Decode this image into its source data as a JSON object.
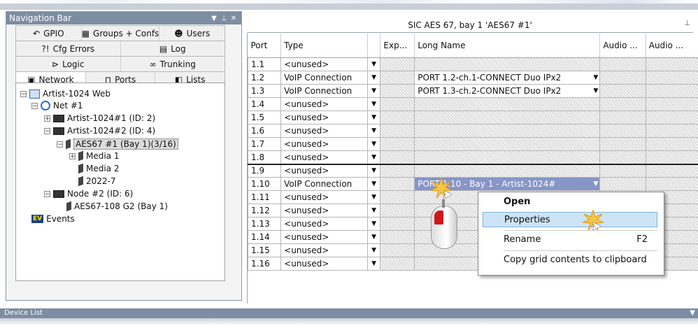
{
  "nav": {
    "title": "Navigation Bar",
    "tabs_row1": [
      {
        "icon": "gpio-icon",
        "glyph": "↶",
        "label": "GPIO"
      },
      {
        "icon": "groups-icon",
        "glyph": "▦",
        "label": "Groups + Confs"
      },
      {
        "icon": "users-icon",
        "glyph": "☻",
        "label": "Users"
      }
    ],
    "tabs_row2": [
      {
        "icon": "cfg-errors-icon",
        "glyph": "?!",
        "label": "Cfg Errors"
      },
      {
        "icon": "log-icon",
        "glyph": "▤",
        "label": "Log"
      }
    ],
    "tabs_row3": [
      {
        "icon": "logic-icon",
        "glyph": "⊳",
        "label": "Logic"
      },
      {
        "icon": "trunking-icon",
        "glyph": "∞",
        "label": "Trunking"
      }
    ],
    "tabs_row4": [
      {
        "icon": "network-icon",
        "glyph": "▣",
        "label": "Network"
      },
      {
        "icon": "ports-icon",
        "glyph": "⊓",
        "label": "Ports"
      },
      {
        "icon": "lists-icon",
        "glyph": "◧",
        "label": "Lists"
      }
    ],
    "tree": {
      "root": "Artist-1024 Web",
      "net": "Net #1",
      "dev1": "Artist-1024#1 (ID: 2)",
      "dev2": "Artist-1024#2 (ID: 4)",
      "aes": "AES67 #1 (Bay  1)(3/16)",
      "media1": "Media 1",
      "media2": "Media 2",
      "y2022": "2022-7",
      "node2": "Node #2 (ID: 6)",
      "aes108": "AES67-108 G2 (Bay  1)",
      "events_badge": "EV",
      "events": "Events"
    }
  },
  "grid": {
    "title": "SIC AES 67, bay 1 'AES67 #1'",
    "headers": {
      "port": "Port",
      "type": "Type",
      "exp": "Exp...",
      "longname": "Long Name",
      "audio1": "Audio ...",
      "audio2": "Audio ..."
    },
    "rows": [
      {
        "port": "1.1",
        "type": "<unused>",
        "long": ""
      },
      {
        "port": "1.2",
        "type": "VoIP Connection",
        "long": "PORT 1.2-ch.1-CONNECT Duo IPx2"
      },
      {
        "port": "1.3",
        "type": "VoIP Connection",
        "long": "PORT 1.3-ch.2-CONNECT Duo IPx2"
      },
      {
        "port": "1.4",
        "type": "<unused>",
        "long": ""
      },
      {
        "port": "1.5",
        "type": "<unused>",
        "long": ""
      },
      {
        "port": "1.6",
        "type": "<unused>",
        "long": ""
      },
      {
        "port": "1.7",
        "type": "<unused>",
        "long": ""
      },
      {
        "port": "1.8",
        "type": "<unused>",
        "long": ""
      },
      {
        "port": "1.9",
        "type": "<unused>",
        "long": ""
      },
      {
        "port": "1.10",
        "type": "VoIP Connection",
        "long": "PORT 1.10 - Bay 1 - Artist-1024#"
      },
      {
        "port": "1.11",
        "type": "<unused>",
        "long": ""
      },
      {
        "port": "1.12",
        "type": "<unused>",
        "long": ""
      },
      {
        "port": "1.13",
        "type": "<unused>",
        "long": ""
      },
      {
        "port": "1.14",
        "type": "<unused>",
        "long": ""
      },
      {
        "port": "1.15",
        "type": "<unused>",
        "long": ""
      },
      {
        "port": "1.16",
        "type": "<unused>",
        "long": ""
      }
    ]
  },
  "context_menu": {
    "open": "Open",
    "properties": "Properties",
    "rename": "Rename",
    "rename_key": "F2",
    "copy": "Copy grid contents to clipboard"
  },
  "device_list": {
    "title": "Device List"
  },
  "colors": {
    "header": "#7d8da3",
    "selection": "#8795c8",
    "menu_highlight": "#cde4f7",
    "mouse_button": "#d3151c"
  }
}
